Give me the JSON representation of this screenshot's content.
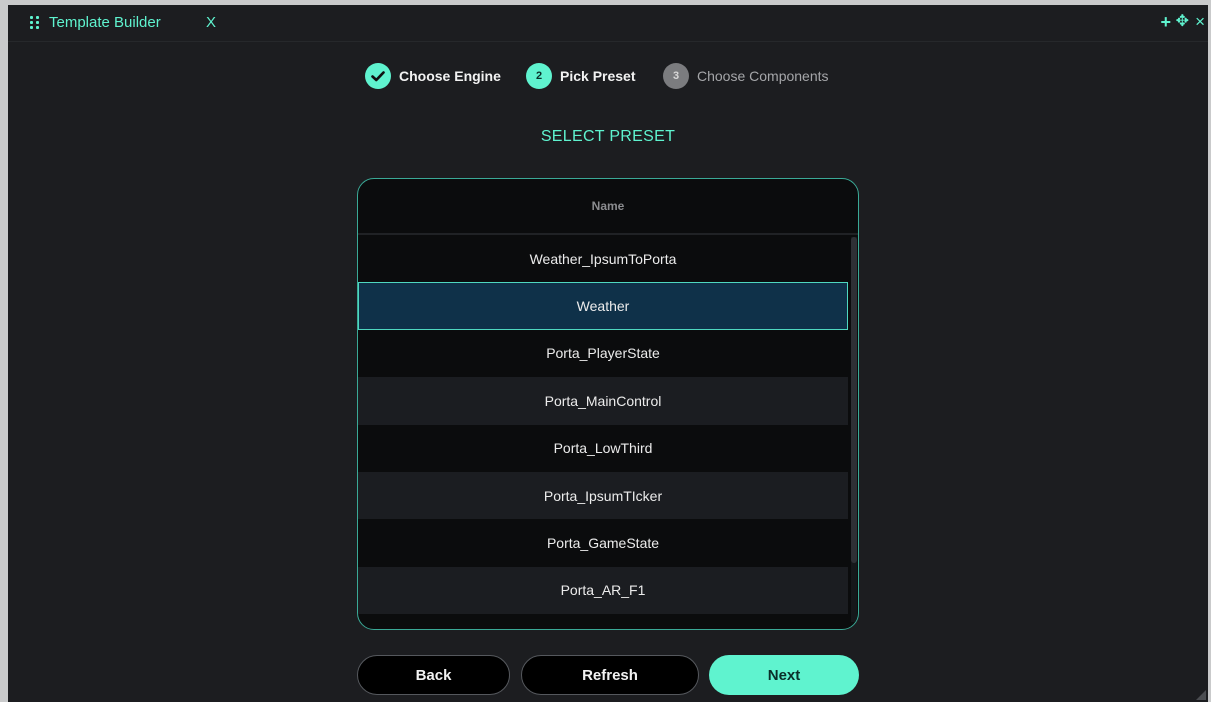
{
  "window": {
    "title": "Template Builder",
    "close_label": "X",
    "controls": {
      "add": "+",
      "move": "✥",
      "close": "×"
    }
  },
  "steps": [
    {
      "number": "✓",
      "label": "Choose Engine",
      "state": "completed"
    },
    {
      "number": "2",
      "label": "Pick Preset",
      "state": "active"
    },
    {
      "number": "3",
      "label": "Choose Components",
      "state": "pending"
    }
  ],
  "heading": "SELECT PRESET",
  "table": {
    "column_header": "Name",
    "rows": [
      "Weather_IpsumToPorta",
      "Weather",
      "Porta_PlayerState",
      "Porta_MainControl",
      "Porta_LowThird",
      "Porta_IpsumTIcker",
      "Porta_GameState",
      "Porta_AR_F1"
    ],
    "selected": "Weather"
  },
  "buttons": {
    "back": "Back",
    "refresh": "Refresh",
    "next": "Next"
  },
  "colors": {
    "accent": "#5ff3cf",
    "background": "#1c1d20",
    "selected_row": "#0f3149",
    "pending_step": "#7b7c7f"
  }
}
